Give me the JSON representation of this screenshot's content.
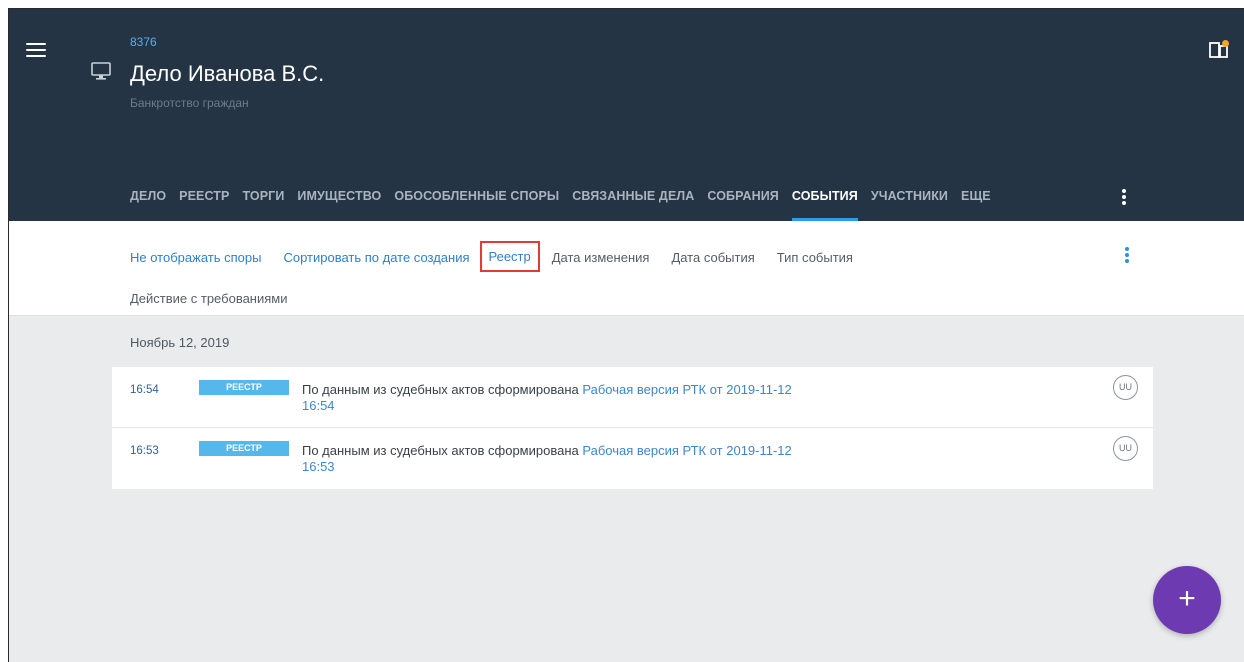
{
  "header": {
    "case_id": "8376",
    "title": "Дело Иванова В.С.",
    "subtitle": "Банкротство граждан",
    "tabs": [
      {
        "label": "ДЕЛО"
      },
      {
        "label": "РЕЕСТР"
      },
      {
        "label": "ТОРГИ"
      },
      {
        "label": "ИМУЩЕСТВО"
      },
      {
        "label": "ОБОСОБЛЕННЫЕ СПОРЫ"
      },
      {
        "label": "СВЯЗАННЫЕ ДЕЛА"
      },
      {
        "label": "СОБРАНИЯ"
      },
      {
        "label": "СОБЫТИЯ"
      },
      {
        "label": "УЧАСТНИКИ"
      },
      {
        "label": "ЕЩЕ"
      }
    ],
    "active_tab": "СОБЫТИЯ"
  },
  "filters": {
    "items": [
      {
        "label": "Не отображать споры"
      },
      {
        "label": "Сортировать по дате создания"
      },
      {
        "label": "Реестр"
      },
      {
        "label": "Дата изменения"
      },
      {
        "label": "Дата события"
      },
      {
        "label": "Тип события"
      }
    ],
    "second_row": "Действие с требованиями"
  },
  "events": {
    "date_heading": "Ноябрь 12, 2019",
    "items": [
      {
        "time": "16:54",
        "badge": "РЕЕСТР",
        "text": "По данным из судебных актов сформирована ",
        "link": "Рабочая версия РТК от 2019-11-12 16:54",
        "user": "UU"
      },
      {
        "time": "16:53",
        "badge": "РЕЕСТР",
        "text": "По данным из судебных актов сформирована ",
        "link": "Рабочая версия РТК от 2019-11-12 16:53",
        "user": "UU"
      }
    ]
  },
  "fab": {
    "label": "+"
  },
  "icons": {
    "menu": "menu-icon",
    "monitor": "monitor-icon",
    "apps": "apps-notification-icon",
    "more": "more-vertical-icon"
  },
  "colors": {
    "header_bg": "#253444",
    "accent": "#2f9be3",
    "badge": "#56b7ea",
    "fab": "#6d3ab2",
    "highlight_box": "#e53935",
    "notification_dot": "#f5a623"
  }
}
